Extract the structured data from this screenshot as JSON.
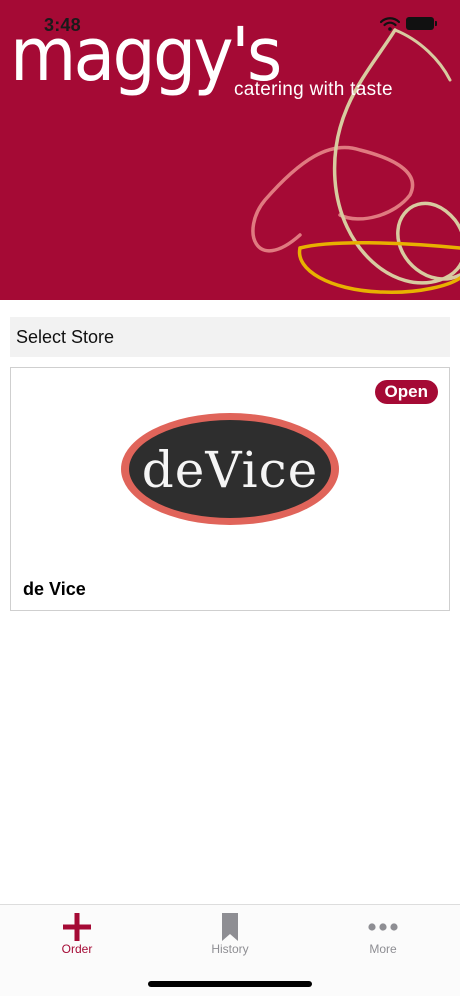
{
  "status_bar": {
    "time": "3:48"
  },
  "brand": {
    "name": "maggy's",
    "tagline": "catering with taste"
  },
  "colors": {
    "brand": "#a50a35",
    "swirl_gold": "#e8b100",
    "swirl_light": "#d8cba0",
    "logo_ring": "#e0645a",
    "logo_fill": "#2e2e2e"
  },
  "section": {
    "title": "Select Store"
  },
  "stores": [
    {
      "name": "de Vice",
      "status": "Open",
      "logo_text": "deVice"
    }
  ],
  "tab_bar": {
    "items": [
      {
        "label": "Order",
        "icon": "plus-icon",
        "active": true
      },
      {
        "label": "History",
        "icon": "bookmark-icon",
        "active": false
      },
      {
        "label": "More",
        "icon": "more-icon",
        "active": false
      }
    ]
  }
}
